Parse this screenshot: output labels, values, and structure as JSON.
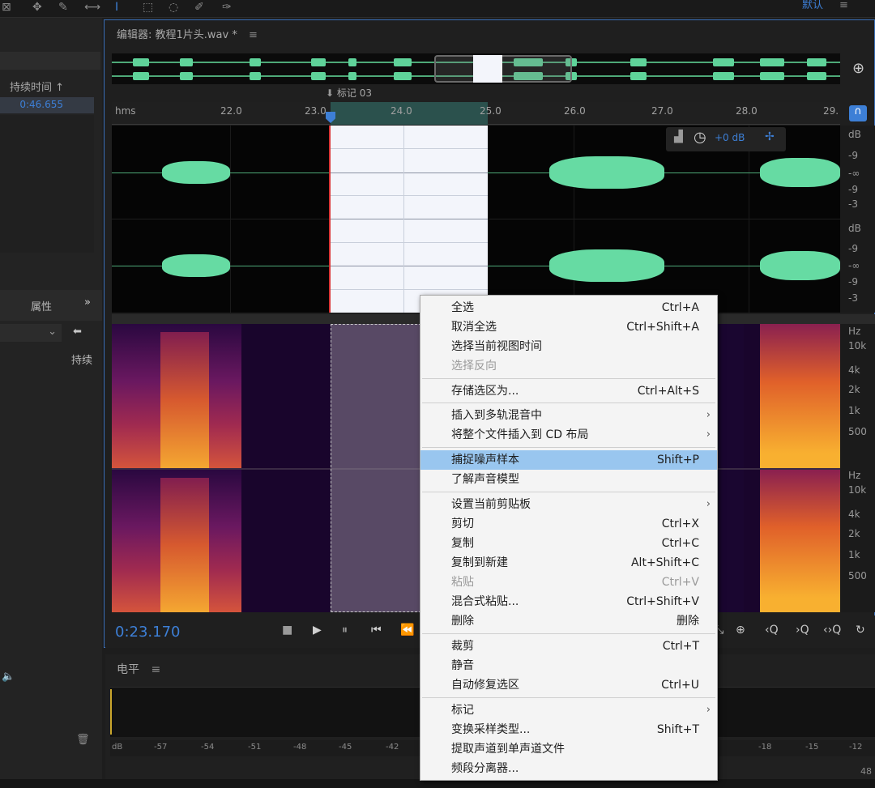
{
  "topbar": {
    "workspace_label": "默认",
    "menu_icon": "hamburger-icon"
  },
  "left_panel": {
    "duration_header": "持续时间",
    "duration_value": "0:46.655",
    "properties_label": "属性",
    "expand_icon": "double-chevron-right-icon",
    "duration_short": "持续"
  },
  "editor": {
    "tab_title": "编辑器: 教程1片头.wav *",
    "marker_label": "标记 03",
    "ruler_unit": "hms",
    "ruler_ticks": [
      "22.0",
      "23.0",
      "24.0",
      "25.0",
      "26.0",
      "27.0",
      "28.0",
      "29."
    ],
    "gain_value": "+0 dB",
    "db_labels_top": [
      "dB",
      "-9",
      "-∞",
      "-9",
      "-3"
    ],
    "db_labels_bottom": [
      "dB",
      "-9",
      "-∞",
      "-9",
      "-3"
    ],
    "hz_labels_top": [
      "Hz",
      "10k",
      "4k",
      "2k",
      "1k",
      "500"
    ],
    "hz_labels_bottom": [
      "Hz",
      "10k",
      "4k",
      "2k",
      "1k",
      "500"
    ]
  },
  "transport": {
    "timecode": "0:23.170"
  },
  "level_panel": {
    "title": "电平",
    "scale": [
      "dB",
      "-57",
      "-54",
      "-51",
      "-48",
      "-45",
      "-42",
      "-18",
      "-15",
      "-12"
    ],
    "right_number": "48"
  },
  "context_menu": {
    "items": [
      {
        "label": "全选",
        "shortcut": "Ctrl+A"
      },
      {
        "label": "取消全选",
        "shortcut": "Ctrl+Shift+A"
      },
      {
        "label": "选择当前视图时间",
        "shortcut": ""
      },
      {
        "label": "选择反向",
        "shortcut": ""
      },
      {
        "label": "存储选区为...",
        "shortcut": "Ctrl+Alt+S"
      },
      {
        "label": "插入到多轨混音中",
        "shortcut": ""
      },
      {
        "label": "将整个文件插入到 CD 布局",
        "shortcut": ""
      },
      {
        "label": "捕捉噪声样本",
        "shortcut": "Shift+P"
      },
      {
        "label": "了解声音模型",
        "shortcut": ""
      },
      {
        "label": "设置当前剪贴板",
        "shortcut": ""
      },
      {
        "label": "剪切",
        "shortcut": "Ctrl+X"
      },
      {
        "label": "复制",
        "shortcut": "Ctrl+C"
      },
      {
        "label": "复制到新建",
        "shortcut": "Alt+Shift+C"
      },
      {
        "label": "粘贴",
        "shortcut": "Ctrl+V"
      },
      {
        "label": "混合式粘贴...",
        "shortcut": "Ctrl+Shift+V"
      },
      {
        "label": "删除",
        "shortcut": "删除"
      },
      {
        "label": "裁剪",
        "shortcut": "Ctrl+T"
      },
      {
        "label": "静音",
        "shortcut": ""
      },
      {
        "label": "自动修复选区",
        "shortcut": "Ctrl+U"
      },
      {
        "label": "标记",
        "shortcut": ""
      },
      {
        "label": "变换采样类型...",
        "shortcut": "Shift+T"
      },
      {
        "label": "提取声道到单声道文件",
        "shortcut": ""
      },
      {
        "label": "频段分离器...",
        "shortcut": ""
      }
    ]
  }
}
